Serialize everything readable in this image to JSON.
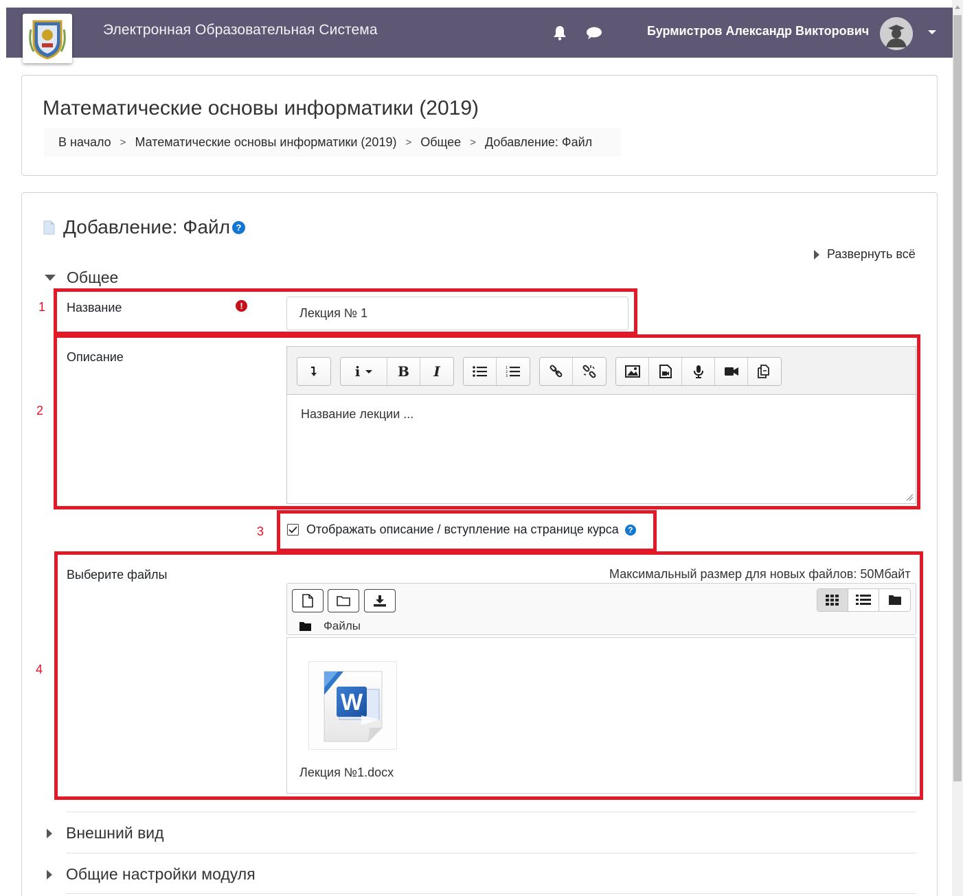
{
  "navbar": {
    "site_title": "Электронная Образовательная Система",
    "user_name": "Бурмистров Александр Викторович",
    "background_color": "#5e5875",
    "icons": [
      "university-logo",
      "bell-icon",
      "chat-icon",
      "avatar-icon",
      "caret-down-icon"
    ]
  },
  "header": {
    "course_title": "Математические основы информатики (2019)",
    "breadcrumb": [
      "В начало",
      "Математические основы информатики (2019)",
      "Общее",
      "Добавление: Файл"
    ],
    "separator": ">"
  },
  "form": {
    "heading": "Добавление: Файл",
    "expand_all": "Развернуть всё",
    "section_general": "Общее",
    "name_label": "Название",
    "name_value": "Лекция № 1",
    "description_label": "Описание",
    "description_content": "Название лекции ...",
    "editor_buttons": [
      "expand-toolbar",
      "info-style",
      "bold",
      "italic",
      "unordered-list",
      "ordered-list",
      "link",
      "unlink",
      "image",
      "media",
      "record-audio",
      "record-video",
      "manage-files"
    ],
    "show_description_label": "Отображать описание / вступление на странице курса",
    "show_description_checked": true,
    "files_label": "Выберите файлы",
    "max_size_text": "Максимальный размер для новых файлов: 50Мбайт",
    "files_path": "Файлы",
    "files": [
      {
        "name": "Лекция №1.docx",
        "icon": "word-document-icon"
      }
    ],
    "collapsed_sections": [
      "Внешний вид",
      "Общие настройки модуля"
    ]
  },
  "annotations": {
    "labels": [
      "1",
      "2",
      "3",
      "4"
    ],
    "box_color": "#e21a27"
  },
  "colors": {
    "accent_blue": "#1177d1",
    "required_red": "#c6111a"
  }
}
